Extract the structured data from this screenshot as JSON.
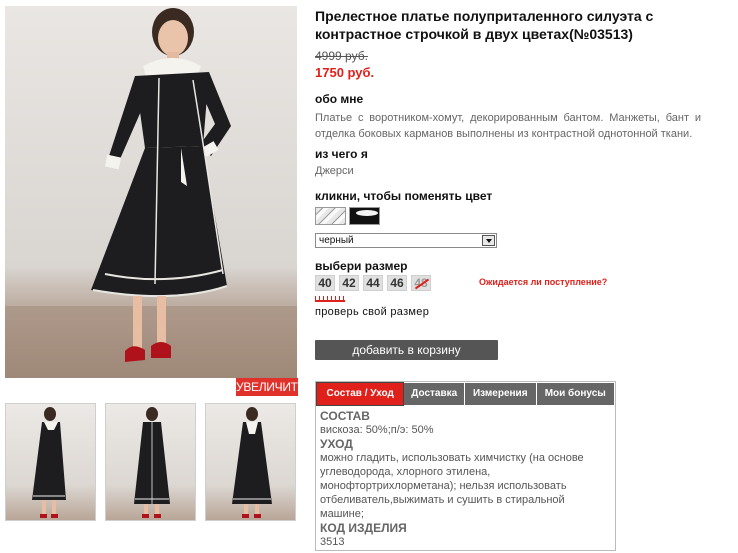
{
  "product": {
    "title": "Прелестное платье полуприталенного силуэта с контрастное строчкой в двух цветах(№03513)",
    "old_price": "4999 руб.",
    "new_price": "1750 руб."
  },
  "gallery": {
    "zoom_label": "УВЕЛИЧИТЬ"
  },
  "about": {
    "heading": "обо мне",
    "text": "Платье с воротником-хомут, декорированным бантом. Манжеты, бант и отделка боковых карманов выполнены из контрастной однотонной ткани."
  },
  "material": {
    "heading": "из чего я",
    "value": "Джерси"
  },
  "color": {
    "heading": "кликни, чтобы поменять цвет",
    "selected": "черный"
  },
  "size": {
    "heading": "выбери размер",
    "options": [
      "40",
      "42",
      "44",
      "46",
      "48"
    ],
    "awaiting_link": "Ожидается ли поступление?",
    "check_size_link": "проверь свой размер"
  },
  "cart": {
    "button_label": "добавить в корзину"
  },
  "tabs": {
    "labels": [
      "Состав / Уход",
      "Доставка",
      "Измерения",
      "Мои бонусы"
    ],
    "panel": {
      "composition_heading": "СОСТАВ",
      "composition_value": "вискоза: 50%;п/э: 50%",
      "care_heading": "УХОД",
      "care_text": "можно гладить, использовать химчистку (на основе углеводорода, хлорного этилена, монофтортрихлорметана); нельзя использовать отбеливатель,выжимать и сушить в стиральной машине;",
      "code_heading": "КОД ИЗДЕЛИЯ",
      "code_value": "3513"
    }
  },
  "colors": {
    "accent_red": "#e0201a",
    "button_gray": "#555555",
    "tab_gray": "#666666"
  }
}
